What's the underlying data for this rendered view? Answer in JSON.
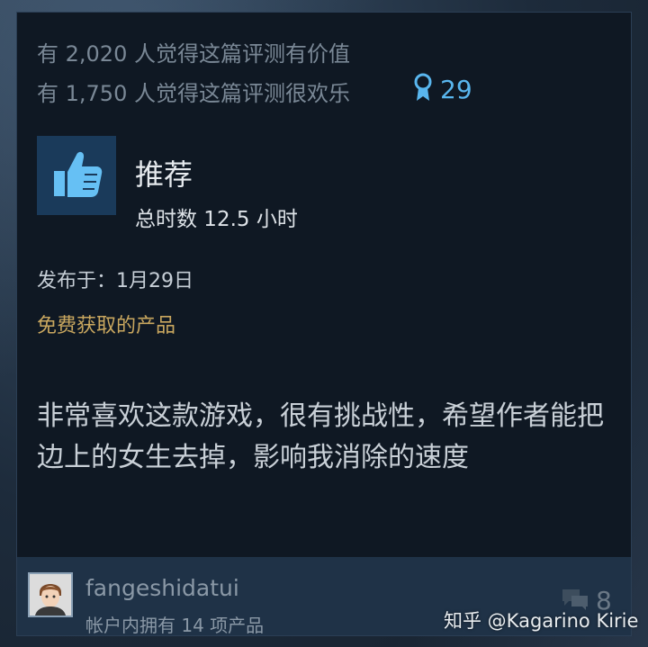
{
  "helpful_line": "有 2,020 人觉得这篇评测有价值",
  "funny_line": "有 1,750 人觉得这篇评测很欢乐",
  "award_count": "29",
  "verdict": "推荐",
  "playtime": "总时数 12.5 小时",
  "posted": "发布于：1月29日",
  "free_product": "免费获取的产品",
  "review_text": "非常喜欢这款游戏，很有挑战性，希望作者能把边上的女生去掉，影响我消除的速度",
  "author": {
    "username": "fangeshidatui",
    "products": "帐户内拥有 14 项产品"
  },
  "comment_count": "8",
  "watermark": "知乎 @Kagarino Kirie",
  "colors": {
    "card_bg": "#0f1823",
    "award_blue": "#59b6ee",
    "free_gold": "#c9a75f",
    "thumb_box": "#1a3a5a"
  },
  "icons": [
    "award-ribbon-icon",
    "thumbs-up-icon",
    "comment-bubbles-icon"
  ]
}
